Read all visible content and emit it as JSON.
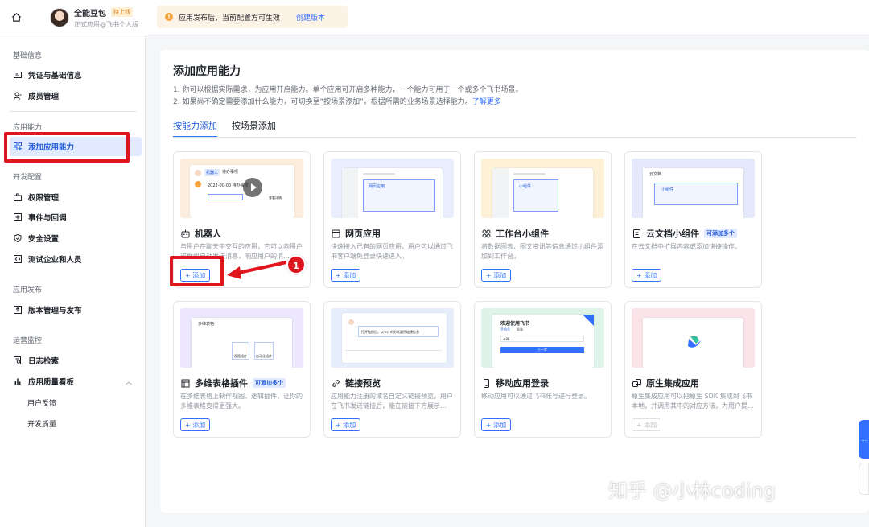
{
  "topbar": {
    "app_name": "全能豆包",
    "status_badge": "待上线",
    "app_subtitle": "正式应用@飞书个人版",
    "notice_text": "应用发布后，当前配置方可生效",
    "notice_link": "创建版本"
  },
  "sidebar": {
    "sections": {
      "basic": "基础信息",
      "capability": "应用能力",
      "dev": "开发配置",
      "release": "应用发布",
      "ops": "运营监控"
    },
    "items": {
      "credentials": "凭证与基础信息",
      "members": "成员管理",
      "add_capability": "添加应用能力",
      "permissions": "权限管理",
      "events": "事件与回调",
      "security": "安全设置",
      "test_tenant": "测试企业和人员",
      "versions": "版本管理与发布",
      "logs": "日志检索",
      "quality": "应用质量看板",
      "feedback": "用户反馈",
      "dev_quality": "开发质量"
    }
  },
  "main": {
    "title": "添加应用能力",
    "desc1": "1. 你可以根据实际需求，为应用开启能力。单个应用可开启多种能力，一个能力可用于一个或多个飞书场景。",
    "desc2": "2. 如果尚不确定需要添加什么能力，可切换至“按场景添加”，根据所需的业务场景选择能力。",
    "desc2_link": "了解更多",
    "tabs": [
      "按能力添加",
      "按场景添加"
    ],
    "add_label": "+ 添加",
    "multi_badge": "可添加多个",
    "cards": [
      {
        "title": "机器人",
        "desc": "与用户在聊天中交互的应用，它可以向用户或群组自动发送消息，响应用户的消…",
        "icon": "robot-icon"
      },
      {
        "title": "网页应用",
        "desc": "快速接入已有的网页应用，用户可以通过飞书客户端免登录快速进入。",
        "icon": "web-app-icon"
      },
      {
        "title": "工作台小组件",
        "desc": "将数据图表、图文资讯等信息通过小组件添加到工作台。",
        "icon": "widget-icon"
      },
      {
        "title": "云文档小组件",
        "desc": "在云文档中扩展内容或添加快捷操作。",
        "icon": "doc-widget-icon"
      },
      {
        "title": "多维表格插件",
        "desc": "在多维表格上制作视图、逻辑插件，让你的多维表格变得更强大。",
        "icon": "bitable-icon"
      },
      {
        "title": "链接预览",
        "desc": "应用能力注册的域名自定义链接预览，用户在飞书发送链接后，能在链接下方展示…",
        "icon": "link-icon"
      },
      {
        "title": "移动应用登录",
        "desc": "移动应用可以通过飞书账号进行登录。",
        "icon": "mobile-icon"
      },
      {
        "title": "原生集成应用",
        "desc": "原生集成应用可以把原生 SDK 集成到飞书本地，并调用其中的对应方法，为用户提…",
        "icon": "native-icon"
      }
    ],
    "thumb_texts": {
      "robot_chip1": "机器人",
      "robot_chip2": "待办事项",
      "robot_date": "2022-00-00 待办事项",
      "robot_btn": "查看详情",
      "web_label": "网页应用",
      "widget_label": "小组件",
      "doc_title": "云文档",
      "doc_label": "小组件",
      "bitable_title": "多维表格",
      "bitable_a": "视图插件",
      "bitable_b": "自动化插件",
      "link_msg": "打开链接后，以卡片的形式展示链接信息",
      "mobile_title": "欢迎使用飞书",
      "mobile_tab1": "手机号",
      "mobile_tab2": "邮箱",
      "mobile_prefix": "+86",
      "mobile_btn": "下一步"
    }
  },
  "annotation": {
    "step": "1"
  },
  "watermark": "知乎 @小林coding",
  "colors": {
    "primary": "#3370ff",
    "highlight_red": "#e0161e",
    "notice_bg": "#fdf2e6"
  }
}
